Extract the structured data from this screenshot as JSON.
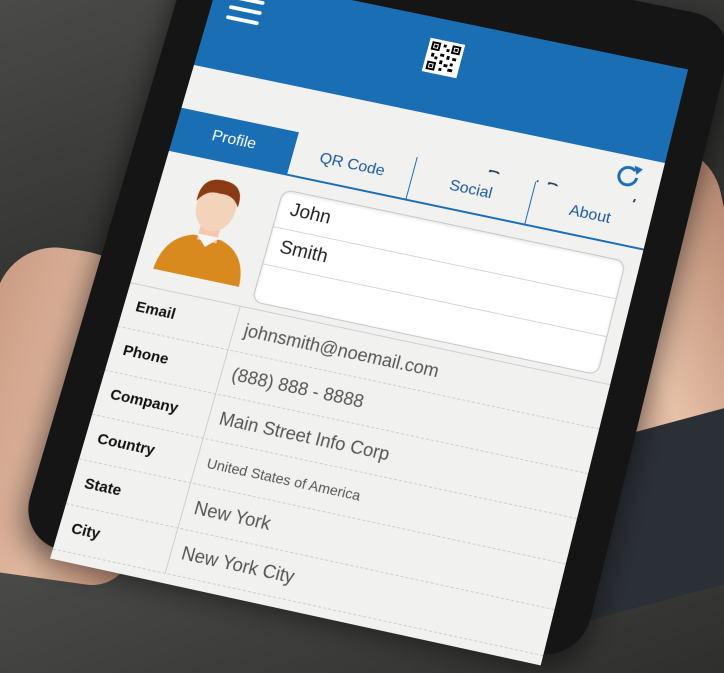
{
  "header": {
    "menu_icon": "hamburger-icon",
    "qr_icon": "qr-code-icon",
    "refresh_icon": "refresh-icon",
    "reset_password_label": "Reset Password",
    "accent_color": "#1a6fb4"
  },
  "tabs": [
    {
      "label": "Profile",
      "active": true
    },
    {
      "label": "QR Code",
      "active": false
    },
    {
      "label": "Social",
      "active": false
    },
    {
      "label": "About",
      "active": false
    }
  ],
  "profile": {
    "avatar_icon": "user-avatar-icon",
    "first_name": "John",
    "last_name": "Smith"
  },
  "details": [
    {
      "label": "Email",
      "value": "johnsmith@noemail.com"
    },
    {
      "label": "Phone",
      "value": "(888) 888 - 8888"
    },
    {
      "label": "Company",
      "value": "Main Street Info Corp"
    },
    {
      "label": "Country",
      "value": "United States of America"
    },
    {
      "label": "State",
      "value": "New York"
    },
    {
      "label": "City",
      "value": "New York City"
    }
  ]
}
